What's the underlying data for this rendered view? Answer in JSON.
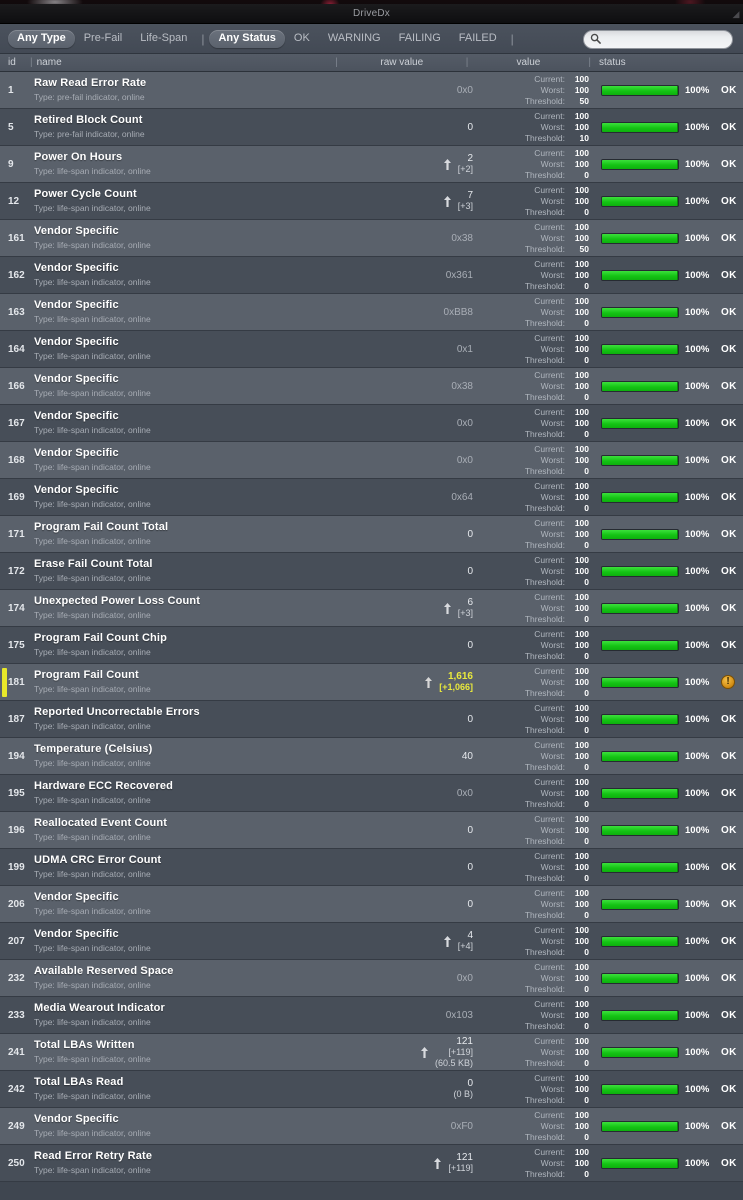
{
  "window": {
    "title": "DriveDx",
    "resize_grip_icon": "resize-grip-icon"
  },
  "toolbar": {
    "type_filters": [
      {
        "label": "Any Type",
        "active": true
      },
      {
        "label": "Pre-Fail",
        "active": false
      },
      {
        "label": "Life-Span",
        "active": false
      }
    ],
    "separator": "|",
    "status_filters": [
      {
        "label": "Any Status",
        "active": true
      },
      {
        "label": "OK",
        "active": false
      },
      {
        "label": "WARNING",
        "active": false
      },
      {
        "label": "FAILING",
        "active": false
      },
      {
        "label": "FAILED",
        "active": false
      }
    ],
    "search": {
      "icon": "search-icon",
      "value": "",
      "placeholder": ""
    }
  },
  "columns": {
    "id": "id",
    "name": "name",
    "raw_value": "raw value",
    "value": "value",
    "status": "status",
    "divider": "|"
  },
  "value_labels": {
    "current": "Current:",
    "worst": "Worst:",
    "threshold": "Threshold:"
  },
  "rows": [
    {
      "id": "1",
      "name": "Raw Read Error Rate",
      "type": "Type: pre-fail indicator, online",
      "raw": "0x0",
      "raw_dim": true,
      "delta": "",
      "extra": "",
      "arrow": false,
      "current": "100",
      "worst": "100",
      "threshold": "50",
      "pct": "100%",
      "bar": 100,
      "status": "OK",
      "warn": false,
      "flagged": false
    },
    {
      "id": "5",
      "name": "Retired Block Count",
      "type": "Type: pre-fail indicator, online",
      "raw": "0",
      "raw_dim": false,
      "delta": "",
      "extra": "",
      "arrow": false,
      "current": "100",
      "worst": "100",
      "threshold": "10",
      "pct": "100%",
      "bar": 100,
      "status": "OK",
      "warn": false,
      "flagged": false
    },
    {
      "id": "9",
      "name": "Power On Hours",
      "type": "Type: life-span indicator, online",
      "raw": "2",
      "raw_dim": false,
      "delta": "[+2]",
      "extra": "",
      "arrow": true,
      "current": "100",
      "worst": "100",
      "threshold": "0",
      "pct": "100%",
      "bar": 100,
      "status": "OK",
      "warn": false,
      "flagged": false
    },
    {
      "id": "12",
      "name": "Power Cycle Count",
      "type": "Type: life-span indicator, online",
      "raw": "7",
      "raw_dim": false,
      "delta": "[+3]",
      "extra": "",
      "arrow": true,
      "current": "100",
      "worst": "100",
      "threshold": "0",
      "pct": "100%",
      "bar": 100,
      "status": "OK",
      "warn": false,
      "flagged": false
    },
    {
      "id": "161",
      "name": "Vendor Specific",
      "type": "Type: life-span indicator, online",
      "raw": "0x38",
      "raw_dim": true,
      "delta": "",
      "extra": "",
      "arrow": false,
      "current": "100",
      "worst": "100",
      "threshold": "50",
      "pct": "100%",
      "bar": 100,
      "status": "OK",
      "warn": false,
      "flagged": false
    },
    {
      "id": "162",
      "name": "Vendor Specific",
      "type": "Type: life-span indicator, online",
      "raw": "0x361",
      "raw_dim": true,
      "delta": "",
      "extra": "",
      "arrow": false,
      "current": "100",
      "worst": "100",
      "threshold": "0",
      "pct": "100%",
      "bar": 100,
      "status": "OK",
      "warn": false,
      "flagged": false
    },
    {
      "id": "163",
      "name": "Vendor Specific",
      "type": "Type: life-span indicator, online",
      "raw": "0xBB8",
      "raw_dim": true,
      "delta": "",
      "extra": "",
      "arrow": false,
      "current": "100",
      "worst": "100",
      "threshold": "0",
      "pct": "100%",
      "bar": 100,
      "status": "OK",
      "warn": false,
      "flagged": false
    },
    {
      "id": "164",
      "name": "Vendor Specific",
      "type": "Type: life-span indicator, online",
      "raw": "0x1",
      "raw_dim": true,
      "delta": "",
      "extra": "",
      "arrow": false,
      "current": "100",
      "worst": "100",
      "threshold": "0",
      "pct": "100%",
      "bar": 100,
      "status": "OK",
      "warn": false,
      "flagged": false
    },
    {
      "id": "166",
      "name": "Vendor Specific",
      "type": "Type: life-span indicator, online",
      "raw": "0x38",
      "raw_dim": true,
      "delta": "",
      "extra": "",
      "arrow": false,
      "current": "100",
      "worst": "100",
      "threshold": "0",
      "pct": "100%",
      "bar": 100,
      "status": "OK",
      "warn": false,
      "flagged": false
    },
    {
      "id": "167",
      "name": "Vendor Specific",
      "type": "Type: life-span indicator, online",
      "raw": "0x0",
      "raw_dim": true,
      "delta": "",
      "extra": "",
      "arrow": false,
      "current": "100",
      "worst": "100",
      "threshold": "0",
      "pct": "100%",
      "bar": 100,
      "status": "OK",
      "warn": false,
      "flagged": false
    },
    {
      "id": "168",
      "name": "Vendor Specific",
      "type": "Type: life-span indicator, online",
      "raw": "0x0",
      "raw_dim": true,
      "delta": "",
      "extra": "",
      "arrow": false,
      "current": "100",
      "worst": "100",
      "threshold": "0",
      "pct": "100%",
      "bar": 100,
      "status": "OK",
      "warn": false,
      "flagged": false
    },
    {
      "id": "169",
      "name": "Vendor Specific",
      "type": "Type: life-span indicator, online",
      "raw": "0x64",
      "raw_dim": true,
      "delta": "",
      "extra": "",
      "arrow": false,
      "current": "100",
      "worst": "100",
      "threshold": "0",
      "pct": "100%",
      "bar": 100,
      "status": "OK",
      "warn": false,
      "flagged": false
    },
    {
      "id": "171",
      "name": "Program Fail Count Total",
      "type": "Type: life-span indicator, online",
      "raw": "0",
      "raw_dim": false,
      "delta": "",
      "extra": "",
      "arrow": false,
      "current": "100",
      "worst": "100",
      "threshold": "0",
      "pct": "100%",
      "bar": 100,
      "status": "OK",
      "warn": false,
      "flagged": false
    },
    {
      "id": "172",
      "name": "Erase Fail Count Total",
      "type": "Type: life-span indicator, online",
      "raw": "0",
      "raw_dim": false,
      "delta": "",
      "extra": "",
      "arrow": false,
      "current": "100",
      "worst": "100",
      "threshold": "0",
      "pct": "100%",
      "bar": 100,
      "status": "OK",
      "warn": false,
      "flagged": false
    },
    {
      "id": "174",
      "name": "Unexpected Power Loss Count",
      "type": "Type: life-span indicator, online",
      "raw": "6",
      "raw_dim": false,
      "delta": "[+3]",
      "extra": "",
      "arrow": true,
      "current": "100",
      "worst": "100",
      "threshold": "0",
      "pct": "100%",
      "bar": 100,
      "status": "OK",
      "warn": false,
      "flagged": false
    },
    {
      "id": "175",
      "name": "Program Fail Count Chip",
      "type": "Type: life-span indicator, online",
      "raw": "0",
      "raw_dim": false,
      "delta": "",
      "extra": "",
      "arrow": false,
      "current": "100",
      "worst": "100",
      "threshold": "0",
      "pct": "100%",
      "bar": 100,
      "status": "OK",
      "warn": false,
      "flagged": false
    },
    {
      "id": "181",
      "name": "Program Fail Count",
      "type": "Type: life-span indicator, online",
      "raw": "1,616",
      "raw_dim": false,
      "delta": "[+1,066]",
      "extra": "",
      "arrow": true,
      "current": "100",
      "worst": "100",
      "threshold": "0",
      "pct": "100%",
      "bar": 100,
      "status": "",
      "warn": true,
      "flagged": true
    },
    {
      "id": "187",
      "name": "Reported Uncorrectable Errors",
      "type": "Type: life-span indicator, online",
      "raw": "0",
      "raw_dim": false,
      "delta": "",
      "extra": "",
      "arrow": false,
      "current": "100",
      "worst": "100",
      "threshold": "0",
      "pct": "100%",
      "bar": 100,
      "status": "OK",
      "warn": false,
      "flagged": false
    },
    {
      "id": "194",
      "name": "Temperature (Celsius)",
      "type": "Type: life-span indicator, online",
      "raw": "40",
      "raw_dim": false,
      "delta": "",
      "extra": "",
      "arrow": false,
      "current": "100",
      "worst": "100",
      "threshold": "0",
      "pct": "100%",
      "bar": 100,
      "status": "OK",
      "warn": false,
      "flagged": false
    },
    {
      "id": "195",
      "name": "Hardware ECC Recovered",
      "type": "Type: life-span indicator, online",
      "raw": "0x0",
      "raw_dim": true,
      "delta": "",
      "extra": "",
      "arrow": false,
      "current": "100",
      "worst": "100",
      "threshold": "0",
      "pct": "100%",
      "bar": 100,
      "status": "OK",
      "warn": false,
      "flagged": false
    },
    {
      "id": "196",
      "name": "Reallocated Event Count",
      "type": "Type: life-span indicator, online",
      "raw": "0",
      "raw_dim": false,
      "delta": "",
      "extra": "",
      "arrow": false,
      "current": "100",
      "worst": "100",
      "threshold": "0",
      "pct": "100%",
      "bar": 100,
      "status": "OK",
      "warn": false,
      "flagged": false
    },
    {
      "id": "199",
      "name": "UDMA CRC Error Count",
      "type": "Type: life-span indicator, online",
      "raw": "0",
      "raw_dim": false,
      "delta": "",
      "extra": "",
      "arrow": false,
      "current": "100",
      "worst": "100",
      "threshold": "0",
      "pct": "100%",
      "bar": 100,
      "status": "OK",
      "warn": false,
      "flagged": false
    },
    {
      "id": "206",
      "name": "Vendor Specific",
      "type": "Type: life-span indicator, online",
      "raw": "0",
      "raw_dim": false,
      "delta": "",
      "extra": "",
      "arrow": false,
      "current": "100",
      "worst": "100",
      "threshold": "0",
      "pct": "100%",
      "bar": 100,
      "status": "OK",
      "warn": false,
      "flagged": false
    },
    {
      "id": "207",
      "name": "Vendor Specific",
      "type": "Type: life-span indicator, online",
      "raw": "4",
      "raw_dim": false,
      "delta": "[+4]",
      "extra": "",
      "arrow": true,
      "current": "100",
      "worst": "100",
      "threshold": "0",
      "pct": "100%",
      "bar": 100,
      "status": "OK",
      "warn": false,
      "flagged": false
    },
    {
      "id": "232",
      "name": "Available Reserved Space",
      "type": "Type: life-span indicator, online",
      "raw": "0x0",
      "raw_dim": true,
      "delta": "",
      "extra": "",
      "arrow": false,
      "current": "100",
      "worst": "100",
      "threshold": "0",
      "pct": "100%",
      "bar": 100,
      "status": "OK",
      "warn": false,
      "flagged": false
    },
    {
      "id": "233",
      "name": "Media Wearout Indicator",
      "type": "Type: life-span indicator, online",
      "raw": "0x103",
      "raw_dim": true,
      "delta": "",
      "extra": "",
      "arrow": false,
      "current": "100",
      "worst": "100",
      "threshold": "0",
      "pct": "100%",
      "bar": 100,
      "status": "OK",
      "warn": false,
      "flagged": false
    },
    {
      "id": "241",
      "name": "Total LBAs Written",
      "type": "Type: life-span indicator, online",
      "raw": "121",
      "raw_dim": false,
      "delta": "[+119]",
      "extra": "(60.5 KB)",
      "arrow": true,
      "current": "100",
      "worst": "100",
      "threshold": "0",
      "pct": "100%",
      "bar": 100,
      "status": "OK",
      "warn": false,
      "flagged": false
    },
    {
      "id": "242",
      "name": "Total LBAs Read",
      "type": "Type: life-span indicator, online",
      "raw": "0",
      "raw_dim": false,
      "delta": "",
      "extra": "(0 B)",
      "arrow": false,
      "current": "100",
      "worst": "100",
      "threshold": "0",
      "pct": "100%",
      "bar": 100,
      "status": "OK",
      "warn": false,
      "flagged": false
    },
    {
      "id": "249",
      "name": "Vendor Specific",
      "type": "Type: life-span indicator, online",
      "raw": "0xF0",
      "raw_dim": true,
      "delta": "",
      "extra": "",
      "arrow": false,
      "current": "100",
      "worst": "100",
      "threshold": "0",
      "pct": "100%",
      "bar": 100,
      "status": "OK",
      "warn": false,
      "flagged": false
    },
    {
      "id": "250",
      "name": "Read Error Retry Rate",
      "type": "Type: life-span indicator, online",
      "raw": "121",
      "raw_dim": false,
      "delta": "[+119]",
      "extra": "",
      "arrow": true,
      "current": "100",
      "worst": "100",
      "threshold": "0",
      "pct": "100%",
      "bar": 100,
      "status": "OK",
      "warn": false,
      "flagged": false
    }
  ]
}
